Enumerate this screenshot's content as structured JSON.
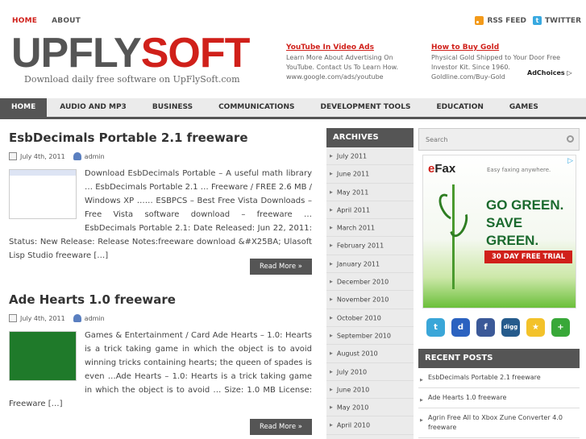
{
  "topnav": {
    "home": "HOME",
    "about": "ABOUT"
  },
  "feeds": {
    "rss": "RSS FEED",
    "twitter": "TWITTER"
  },
  "logo": {
    "part1": "UPFLY",
    "part2": "SOFT",
    "tagline": "Download daily free software on UpFlySoft.com"
  },
  "ads": [
    {
      "title": "YouTube In Video Ads",
      "body": "Learn More About Advertising On YouTube. Contact Us To Learn How.",
      "url": "www.google.com/ads/youtube"
    },
    {
      "title": "How to Buy Gold",
      "body": "Physical Gold Shipped to Your Door Free Investor Kit. Since 1960.",
      "url": "Goldline.com/Buy-Gold"
    }
  ],
  "adchoices": "AdChoices ▷",
  "mainnav": [
    "HOME",
    "AUDIO AND MP3",
    "BUSINESS",
    "COMMUNICATIONS",
    "DEVELOPMENT TOOLS",
    "EDUCATION",
    "GAMES"
  ],
  "posts": [
    {
      "title": "EsbDecimals Portable 2.1 freeware",
      "date": "July 4th, 2011",
      "author": "admin",
      "excerpt": "Download EsbDecimals Portable – A useful math library … EsbDecimals Portable 2.1 … Freeware / FREE 2.6 MB / Windows XP …… ESBPCS – Best Free Vista Downloads – Free Vista software download – freeware … EsbDecimals Portable 2.1: Date Released: Jun 22, 2011: Status: New Release: Release Notes:freeware download &#X25BA; Ulasoft Lisp Studio freeware […]",
      "readmore": "Read More »"
    },
    {
      "title": "Ade Hearts 1.0 freeware",
      "date": "July 4th, 2011",
      "author": "admin",
      "excerpt": "Games & Entertainment / Card Ade Hearts – 1.0: Hearts is a trick taking game in which the object is to avoid winning tricks containing hearts; the queen of spades is even …Ade Hearts – 1.0: Hearts is a trick taking game in which the object is to avoid … Size: 1.0 MB License: Freeware […]",
      "readmore": "Read More »"
    }
  ],
  "archives": {
    "title": "ARCHIVES",
    "items": [
      "July 2011",
      "June 2011",
      "May 2011",
      "April 2011",
      "March 2011",
      "February 2011",
      "January 2011",
      "December 2010",
      "November 2010",
      "October 2010",
      "September 2010",
      "August 2010",
      "July 2010",
      "June 2010",
      "May 2010",
      "April 2010"
    ]
  },
  "search": {
    "placeholder": "Search"
  },
  "banner": {
    "brand_e": "e",
    "brand": "Fax",
    "tagline": "Easy faxing anywhere.",
    "line1": "GO GREEN.",
    "line2": "SAVE GREEN.",
    "cta": "30 DAY FREE TRIAL"
  },
  "social": [
    "t",
    "d",
    "f",
    "digg",
    "★",
    "+"
  ],
  "recent": {
    "title": "RECENT POSTS",
    "items": [
      "EsbDecimals Portable 2.1 freeware",
      "Ade Hearts 1.0 freeware",
      "Agrin Free All to Xbox Zune Converter 4.0 freeware"
    ]
  }
}
